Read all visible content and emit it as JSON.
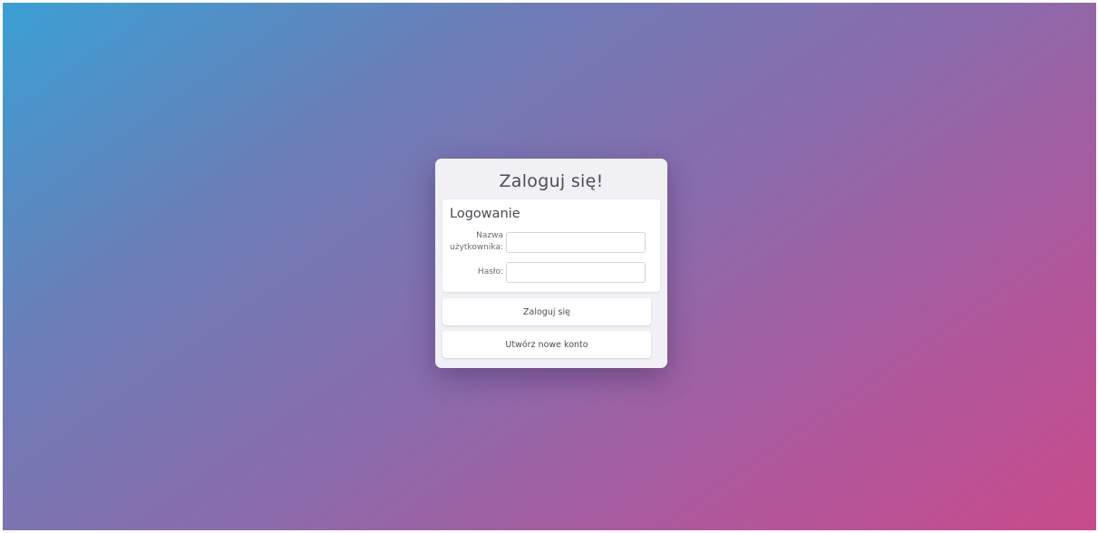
{
  "login_card": {
    "title": "Zaloguj się!",
    "fieldset_legend": "Logowanie",
    "username": {
      "label": "Nazwa użytkownika:",
      "value": "",
      "placeholder": ""
    },
    "password": {
      "label": "Hasło:",
      "value": "",
      "placeholder": ""
    },
    "login_button_label": "Zaloguj się",
    "register_button_label": "Utwórz nowe konto"
  },
  "colors": {
    "gradient_start": "#3aa0d4",
    "gradient_mid": "#8d6aab",
    "gradient_end": "#c84b8c",
    "card_background": "#f1f0f5"
  }
}
